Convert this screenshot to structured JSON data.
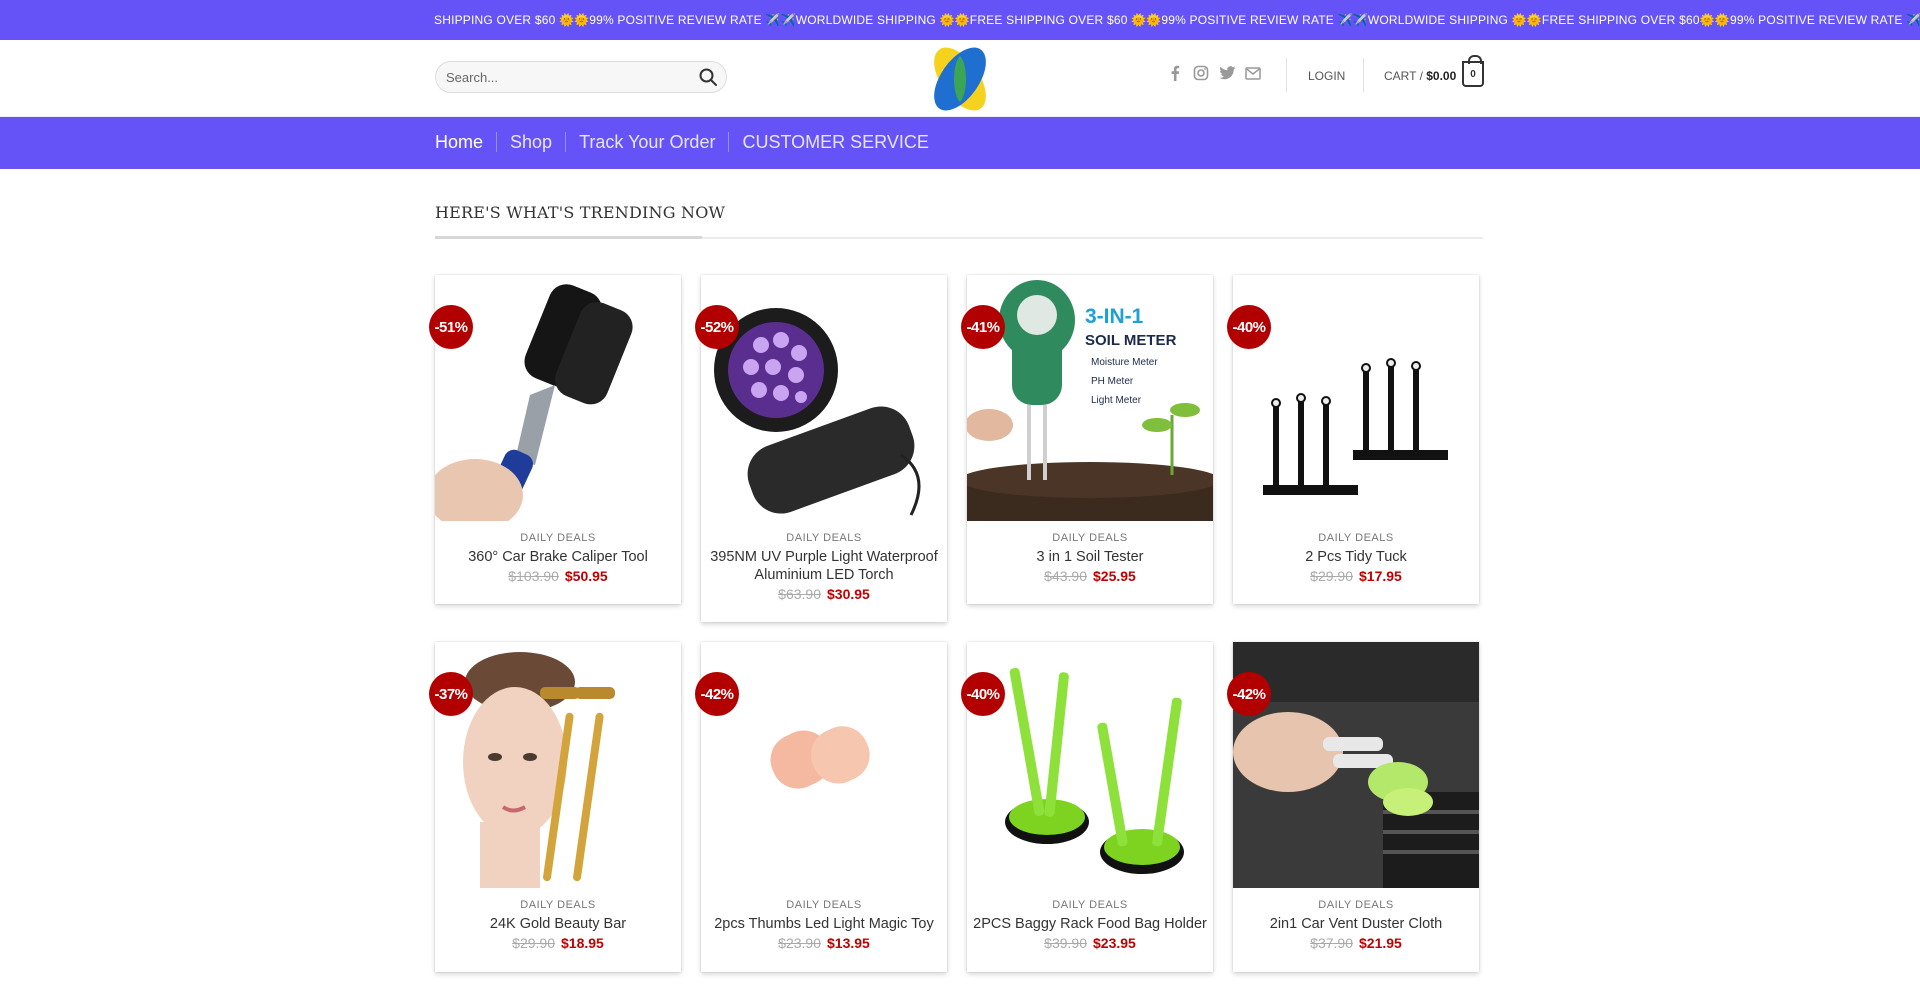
{
  "announcement": {
    "ticker": "SHIPPING OVER $60 🌞🌞99% POSITIVE REVIEW RATE ✈️✈️WORLDWIDE SHIPPING 🌞🌞FREE SHIPPING OVER $60 🌞🌞99% POSITIVE REVIEW RATE ✈️✈️WORLDWIDE SHIPPING 🌞🌞FREE SHIPPING OVER $60🌞🌞99% POSITIVE REVIEW RATE ✈️✈️WORLDWIDE SHIPPING 🌞🌞"
  },
  "header": {
    "search_placeholder": "Search...",
    "social_icons": [
      "facebook-icon",
      "instagram-icon",
      "twitter-icon",
      "email-icon"
    ],
    "login_label": "LOGIN",
    "cart_label": "CART /",
    "cart_total": "$0.00",
    "cart_count": "0"
  },
  "nav": {
    "items": [
      "Home",
      "Shop",
      "Track Your Order",
      "CUSTOMER SERVICE"
    ]
  },
  "section": {
    "title": "HERE'S WHAT'S TRENDING NOW"
  },
  "colors": {
    "brand": "#6553f7",
    "sale_badge": "#b20000",
    "price": "#c10000"
  },
  "products": [
    {
      "badge": "-51%",
      "category": "DAILY DEALS",
      "name": "360° Car Brake Caliper Tool",
      "old_price": "$103.90",
      "price": "$50.95"
    },
    {
      "badge": "-52%",
      "category": "DAILY DEALS",
      "name": "395NM UV Purple Light Waterproof Aluminium LED Torch",
      "old_price": "$63.90",
      "price": "$30.95"
    },
    {
      "badge": "-41%",
      "category": "DAILY DEALS",
      "name": "3 in 1 Soil Tester",
      "old_price": "$43.90",
      "price": "$25.95",
      "image_text": {
        "headline": "3-IN-1",
        "sub": "SOIL METER",
        "features": [
          "Moisture Meter",
          "PH Meter",
          "Light Meter"
        ]
      }
    },
    {
      "badge": "-40%",
      "category": "DAILY DEALS",
      "name": "2 Pcs Tidy Tuck",
      "old_price": "$29.90",
      "price": "$17.95"
    },
    {
      "badge": "-37%",
      "category": "DAILY DEALS",
      "name": "24K Gold Beauty Bar",
      "old_price": "$29.90",
      "price": "$18.95"
    },
    {
      "badge": "-42%",
      "category": "DAILY DEALS",
      "name": "2pcs Thumbs Led Light Magic Toy",
      "old_price": "$23.90",
      "price": "$13.95"
    },
    {
      "badge": "-40%",
      "category": "DAILY DEALS",
      "name": "2PCS Baggy Rack Food Bag Holder",
      "old_price": "$39.90",
      "price": "$23.95"
    },
    {
      "badge": "-42%",
      "category": "DAILY DEALS",
      "name": "2in1 Car Vent Duster Cloth",
      "old_price": "$37.90",
      "price": "$21.95"
    }
  ]
}
